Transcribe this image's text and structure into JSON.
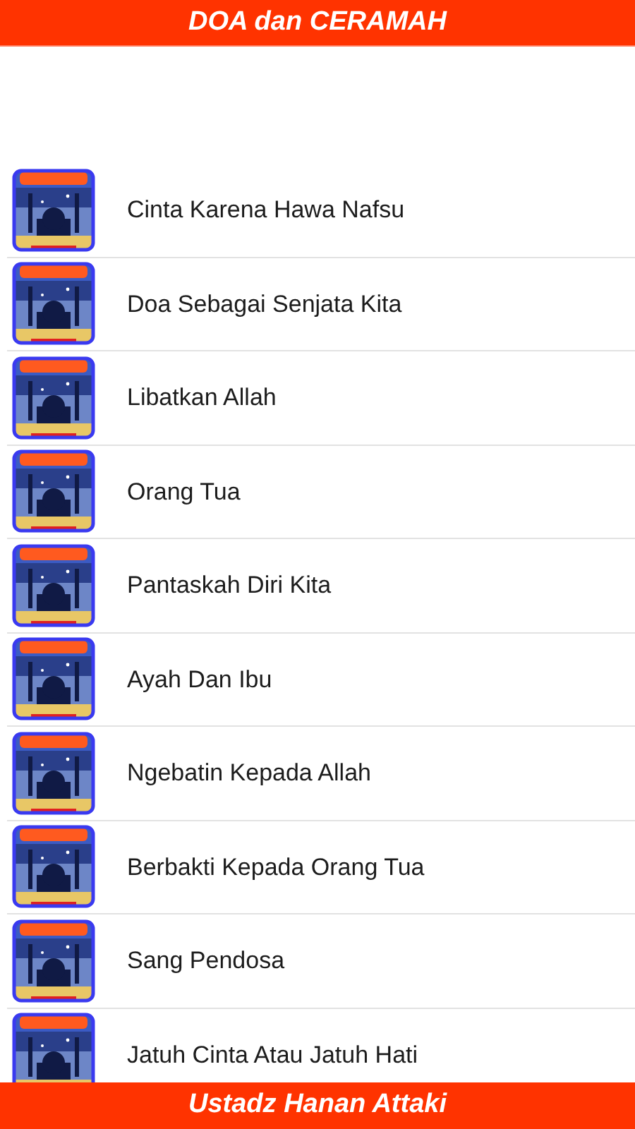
{
  "header": {
    "title": "DOA dan CERAMAH"
  },
  "items": [
    {
      "title": "Cinta Karena Hawa Nafsu"
    },
    {
      "title": "Doa Sebagai Senjata Kita"
    },
    {
      "title": "Libatkan Allah"
    },
    {
      "title": "Orang Tua"
    },
    {
      "title": "Pantaskah Diri Kita"
    },
    {
      "title": "Ayah Dan Ibu"
    },
    {
      "title": "Ngebatin Kepada Allah"
    },
    {
      "title": "Berbakti Kepada Orang Tua"
    },
    {
      "title": "Sang Pendosa"
    },
    {
      "title": "Jatuh Cinta Atau Jatuh Hati"
    }
  ],
  "footer": {
    "title": "Ustadz Hanan Attaki"
  }
}
